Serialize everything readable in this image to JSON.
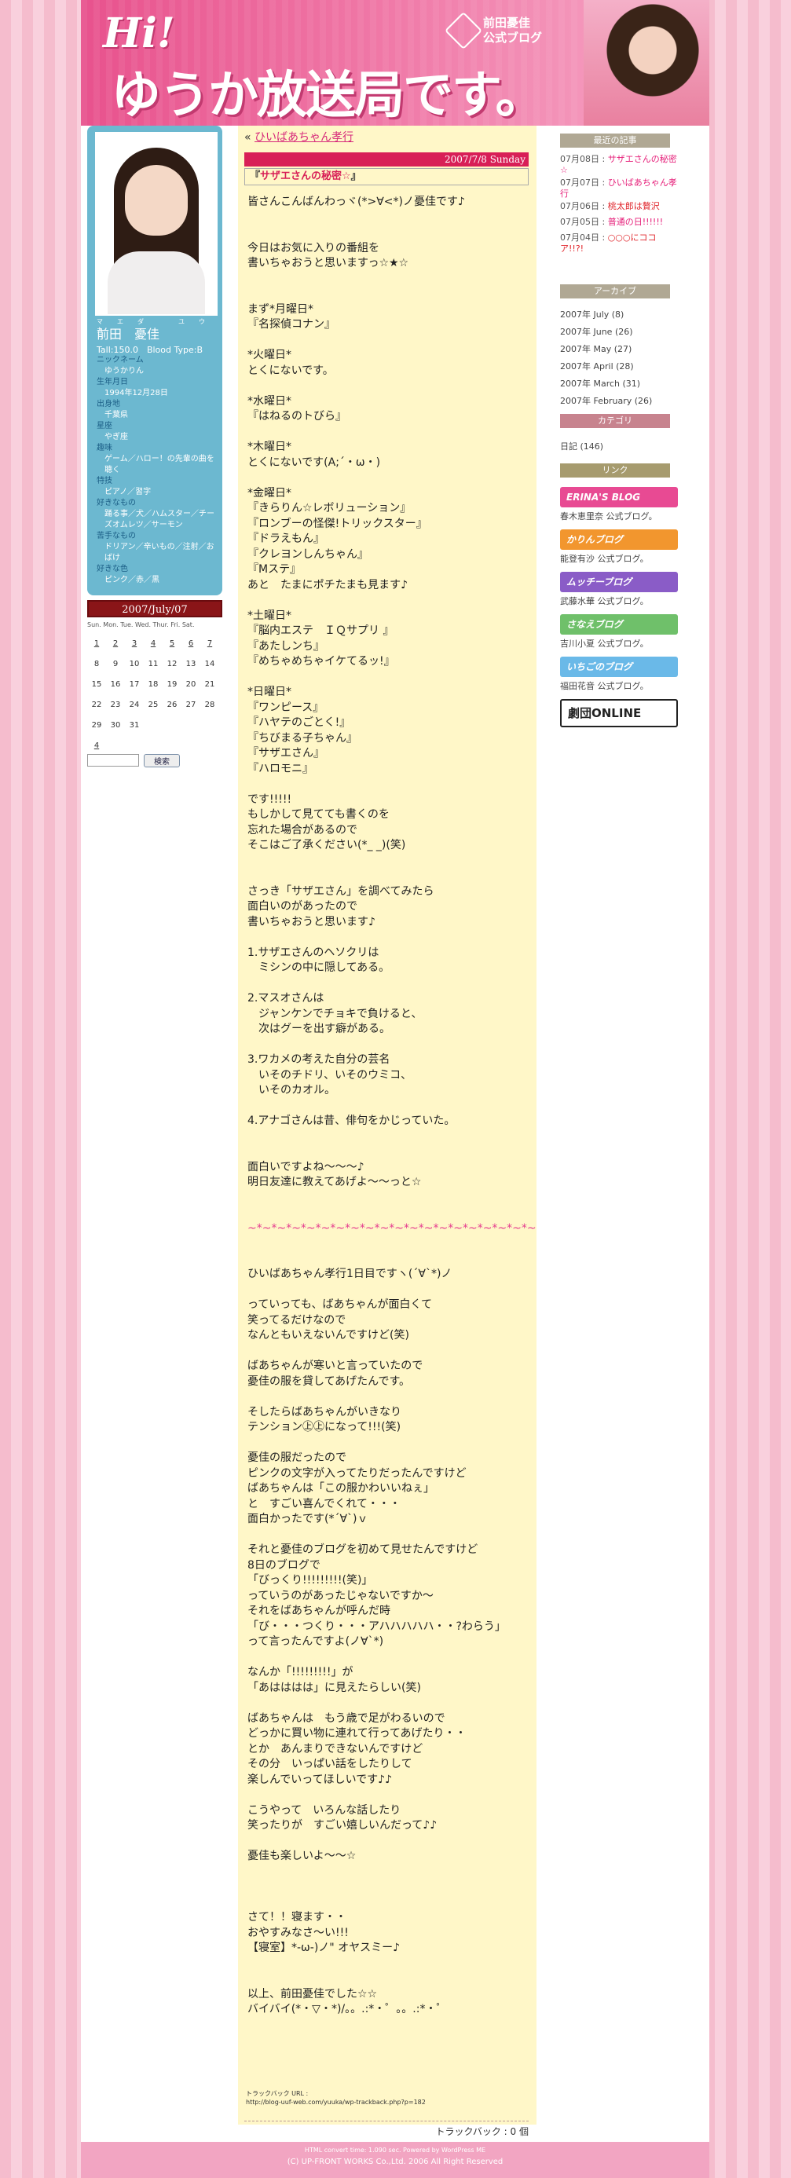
{
  "header": {
    "hi": "Hi!",
    "title": "ゆうか放送局です。",
    "logo_line1": "前田憂佳",
    "logo_line2": "公式ブログ"
  },
  "profile": {
    "ruby": "マエダ　ユウカ",
    "name": "前田　憂佳",
    "stats": "Tall:150.0　Blood Type:B",
    "fields": [
      {
        "label": "ニックネーム",
        "value": "ゆうかりん"
      },
      {
        "label": "生年月日",
        "value": "1994年12月28日"
      },
      {
        "label": "出身地",
        "value": "千葉県"
      },
      {
        "label": "星座",
        "value": "やぎ座"
      },
      {
        "label": "趣味",
        "value": "ゲーム／ハロー！の先輩の曲を聴く"
      },
      {
        "label": "特技",
        "value": "ピアノ／習字"
      },
      {
        "label": "好きなもの",
        "value": "踊る事／犬／ハムスター／チーズオムレツ／サーモン"
      },
      {
        "label": "苦手なもの",
        "value": "ドリアン／辛いもの／注射／おばけ"
      },
      {
        "label": "好きな色",
        "value": "ピンク／赤／黒"
      }
    ]
  },
  "calendar": {
    "title": "2007/July/07",
    "weekdays": "Sun. Mon. Tue. Wed. Thur. Fri. Sat.",
    "weeks": [
      [
        "1",
        "2",
        "3",
        "4",
        "5",
        "6",
        "7"
      ],
      [
        "8",
        "9",
        "10",
        "11",
        "12",
        "13",
        "14"
      ],
      [
        "15",
        "16",
        "17",
        "18",
        "19",
        "20",
        "21"
      ],
      [
        "22",
        "23",
        "24",
        "25",
        "26",
        "27",
        "28"
      ],
      [
        "29",
        "30",
        "31",
        "",
        "",
        "",
        ""
      ],
      [
        "4",
        "",
        "",
        "",
        "",
        "",
        ""
      ]
    ]
  },
  "search": {
    "button": "検索"
  },
  "post": {
    "crumb_prefix": "«",
    "crumb_link": "ひいばあちゃん孝行",
    "date": "2007/7/8 Sunday",
    "title_open": "『",
    "title": "サザエさんの秘密☆",
    "title_close": "』",
    "body": "皆さんこんばんわっヾ(*>∀<*)ノ憂佳です♪\n\n\n今日はお気に入りの番組を\n書いちゃおうと思いますっ☆★☆\n\n\nまず*月曜日*\n『名探偵コナン』\n\n*火曜日*\nとくにないです。\n\n*水曜日*\n『はねるのトびら』\n\n*木曜日*\nとくにないです(A;´・ω・)\n\n*金曜日*\n『きらりん☆レボリューション』\n『ロンブーの怪傑!トリックスター』\n『ドラえもん』\n『クレヨンしんちゃん』\n『Mステ』\nあと　たまにポチたまも見ます♪\n\n*土曜日*\n『脳内エステ　ＩＱサプリ 』\n『あたしンち』\n『めちゃめちゃイケてるッ!』\n\n*日曜日*\n『ワンピース』\n『ハヤテのごとく!』\n『ちびまる子ちゃん』\n『サザエさん』\n『ハロモニ』\n\nです!!!!!\nもしかして見てても書くのを\n忘れた場合があるので\nそこはご了承ください(*_ _)(笑)\n\n\nさっき「サザエさん」を調べてみたら\n面白いのがあったので\n書いちゃおうと思います♪\n\n1.サザエさんのヘソクリは\n　ミシンの中に隠してある。\n\n2.マスオさんは\n　ジャンケンでチョキで負けると、\n　次はグーを出す癖がある。\n\n3.ワカメの考えた自分の芸名\n　いそのチドリ、いそのウミコ、\n　いそのカオル。\n\n4.アナゴさんは昔、俳句をかじっていた。\n\n\n面白いですよね～～～♪\n明日友達に教えてあげよ～～っと☆\n\n\n",
    "divider": "~*~*~*~*~*~*~*~*~*~*~*~*~*~*~*~*~*~*~*~",
    "body2": "\n\n\nひいばあちゃん孝行1日目ですヽ(´∀`*)ノ\n\nっていっても、ばあちゃんが面白くて\n笑ってるだけなので\nなんともいえないんですけど(笑)\n\nばあちゃんが寒いと言っていたので\n憂佳の服を貸してあげたんです。\n\nそしたらばあちゃんがいきなり\nテンション㊤㊤になって!!!(笑)\n\n憂佳の服だったので\nピンクの文字が入ってたりだったんですけど\nばあちゃんは「この服かわいいねぇ」\nと　すごい喜んでくれて・・・\n面白かったです(*´∀`)ｖ\n\nそれと憂佳のブログを初めて見せたんですけど\n8日のブログで\n「びっくり!!!!!!!!!(笑)」\nっていうのがあったじゃないですか～\nそれをばあちゃんが呼んだ時\n「び・・・つくり・・・アハハハハハ・・?わらう」\nって言ったんですよ(ノ∀`*)\n\nなんか「!!!!!!!!!」が\n「あはははは」に見えたらしい(笑)\n\nばあちゃんは　もう歳で足がわるいので\nどっかに買い物に連れて行ってあげたり・・\nとか　あんまりできないんですけど\nその分　いっぱい話をしたりして\n楽しんでいってほしいです♪♪\n\nこうやって　いろんな話したり\n笑ったりが　すごい嬉しいんだって♪♪\n\n憂佳も楽しいよ～～☆\n\n\n\nさて！！寝ます・・\nおやすみなさ～い!!!\n【寝室】*-ω-)ノ\" オヤスミー♪\n\n\n以上、前田憂佳でした☆☆\nバイバイ(*・▽・*)/。。.:*・゜。。.:*・゜",
    "trackback_label": "トラックバック URL :",
    "trackback_url": "http://blog-uuf-web.com/yuuka/wp-trackback.php?p=182",
    "trackback_count": "トラックバック : 0 個"
  },
  "recent": {
    "heading": "最近の記事",
    "items": [
      {
        "date": "07月08日 :",
        "title": "サザエさんの秘密☆",
        "color": "pink"
      },
      {
        "date": "07月07日 :",
        "title": "ひいばあちゃん孝行",
        "color": "pink"
      },
      {
        "date": "07月06日 :",
        "title": "桃太郎は贅沢",
        "color": "red"
      },
      {
        "date": "07月05日 :",
        "title": "普通の日!!!!!!",
        "color": "pink"
      },
      {
        "date": "07月04日 :",
        "title": "○○○にココア!!?!",
        "color": "red"
      }
    ]
  },
  "archive": {
    "heading": "アーカイブ",
    "items": [
      "2007年 July (8)",
      "2007年 June (26)",
      "2007年 May (27)",
      "2007年 April (28)",
      "2007年 March (31)",
      "2007年 February (26)"
    ]
  },
  "category": {
    "heading": "カテゴリ",
    "items": [
      "日記 (146)"
    ]
  },
  "links": {
    "heading": "リンク",
    "banners": [
      {
        "label": "ERINA'S BLOG",
        "caption": "春木恵里奈 公式ブログ。",
        "color": "#e84a93"
      },
      {
        "label": "かりんブログ",
        "caption": "能登有沙 公式ブログ。",
        "color": "#f2962e"
      },
      {
        "label": "ムッチーブログ",
        "caption": "武藤水華 公式ブログ。",
        "color": "#8a5cc7"
      },
      {
        "label": "さなえブログ",
        "caption": "吉川小夏 公式ブログ。",
        "color": "#6fc06a"
      },
      {
        "label": "いちごのブログ",
        "caption": "福田花音 公式ブログ。",
        "color": "#6ab9e8"
      },
      {
        "label": "劇団ONLINE",
        "caption": "",
        "color": "#ffffff"
      }
    ]
  },
  "footer": {
    "line1": "HTML convert time: 1.090 sec. Powered by WordPress ME",
    "line2": "(C) UP-FRONT WORKS Co.,Ltd. 2006 All Right Reserved"
  }
}
